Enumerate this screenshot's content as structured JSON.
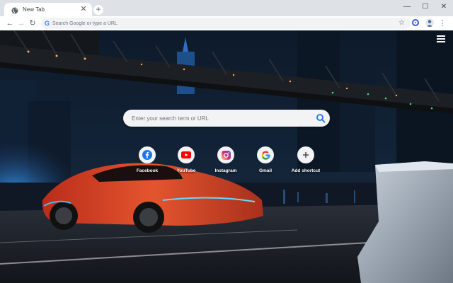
{
  "browser": {
    "tab": {
      "title": "New Tab"
    },
    "new_tab_symbol": "+",
    "window_controls": {
      "minimize": "—",
      "maximize": "☐",
      "close": "✕"
    },
    "toolbar": {
      "back": "←",
      "forward": "→",
      "reload": "↻",
      "omnibox_placeholder": "Search Google or type a URL",
      "omnibox_value": "",
      "bookmark_star": "☆",
      "menu": "⋮"
    }
  },
  "newtab": {
    "search": {
      "placeholder": "Enter your search term or URL",
      "value": ""
    },
    "shortcuts": [
      {
        "label": "Facebook",
        "icon": "facebook-icon",
        "color": "#1877f2"
      },
      {
        "label": "YouTube",
        "icon": "youtube-icon",
        "color": "#ff0000"
      },
      {
        "label": "Instagram",
        "icon": "instagram-icon",
        "color": "#c13584"
      },
      {
        "label": "Gmail",
        "icon": "google-icon",
        "color": "#4285f4"
      },
      {
        "label": "Add shortcut",
        "icon": "plus-icon",
        "color": "#3c4043"
      }
    ],
    "background": "night city bridge with orange sports car"
  }
}
